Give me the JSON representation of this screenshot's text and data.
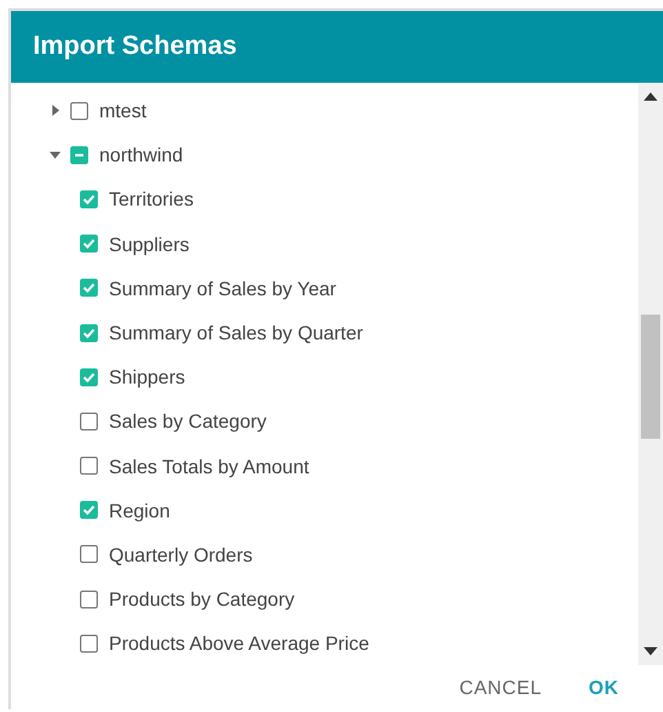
{
  "dialog": {
    "title": "Import Schemas"
  },
  "tree": [
    {
      "label": "mtest",
      "expanded": false,
      "checked": false,
      "indeterminate": false
    },
    {
      "label": "northwind",
      "expanded": true,
      "checked": false,
      "indeterminate": true,
      "children": [
        {
          "label": "Territories",
          "checked": true
        },
        {
          "label": "Suppliers",
          "checked": true
        },
        {
          "label": "Summary of Sales by Year",
          "checked": true
        },
        {
          "label": "Summary of Sales by Quarter",
          "checked": true
        },
        {
          "label": "Shippers",
          "checked": true
        },
        {
          "label": "Sales by Category",
          "checked": false
        },
        {
          "label": "Sales Totals by Amount",
          "checked": false
        },
        {
          "label": "Region",
          "checked": true
        },
        {
          "label": "Quarterly Orders",
          "checked": false
        },
        {
          "label": "Products by Category",
          "checked": false
        },
        {
          "label": "Products Above Average Price",
          "checked": false
        }
      ]
    }
  ],
  "buttons": [
    "CANCEL",
    "OK"
  ]
}
